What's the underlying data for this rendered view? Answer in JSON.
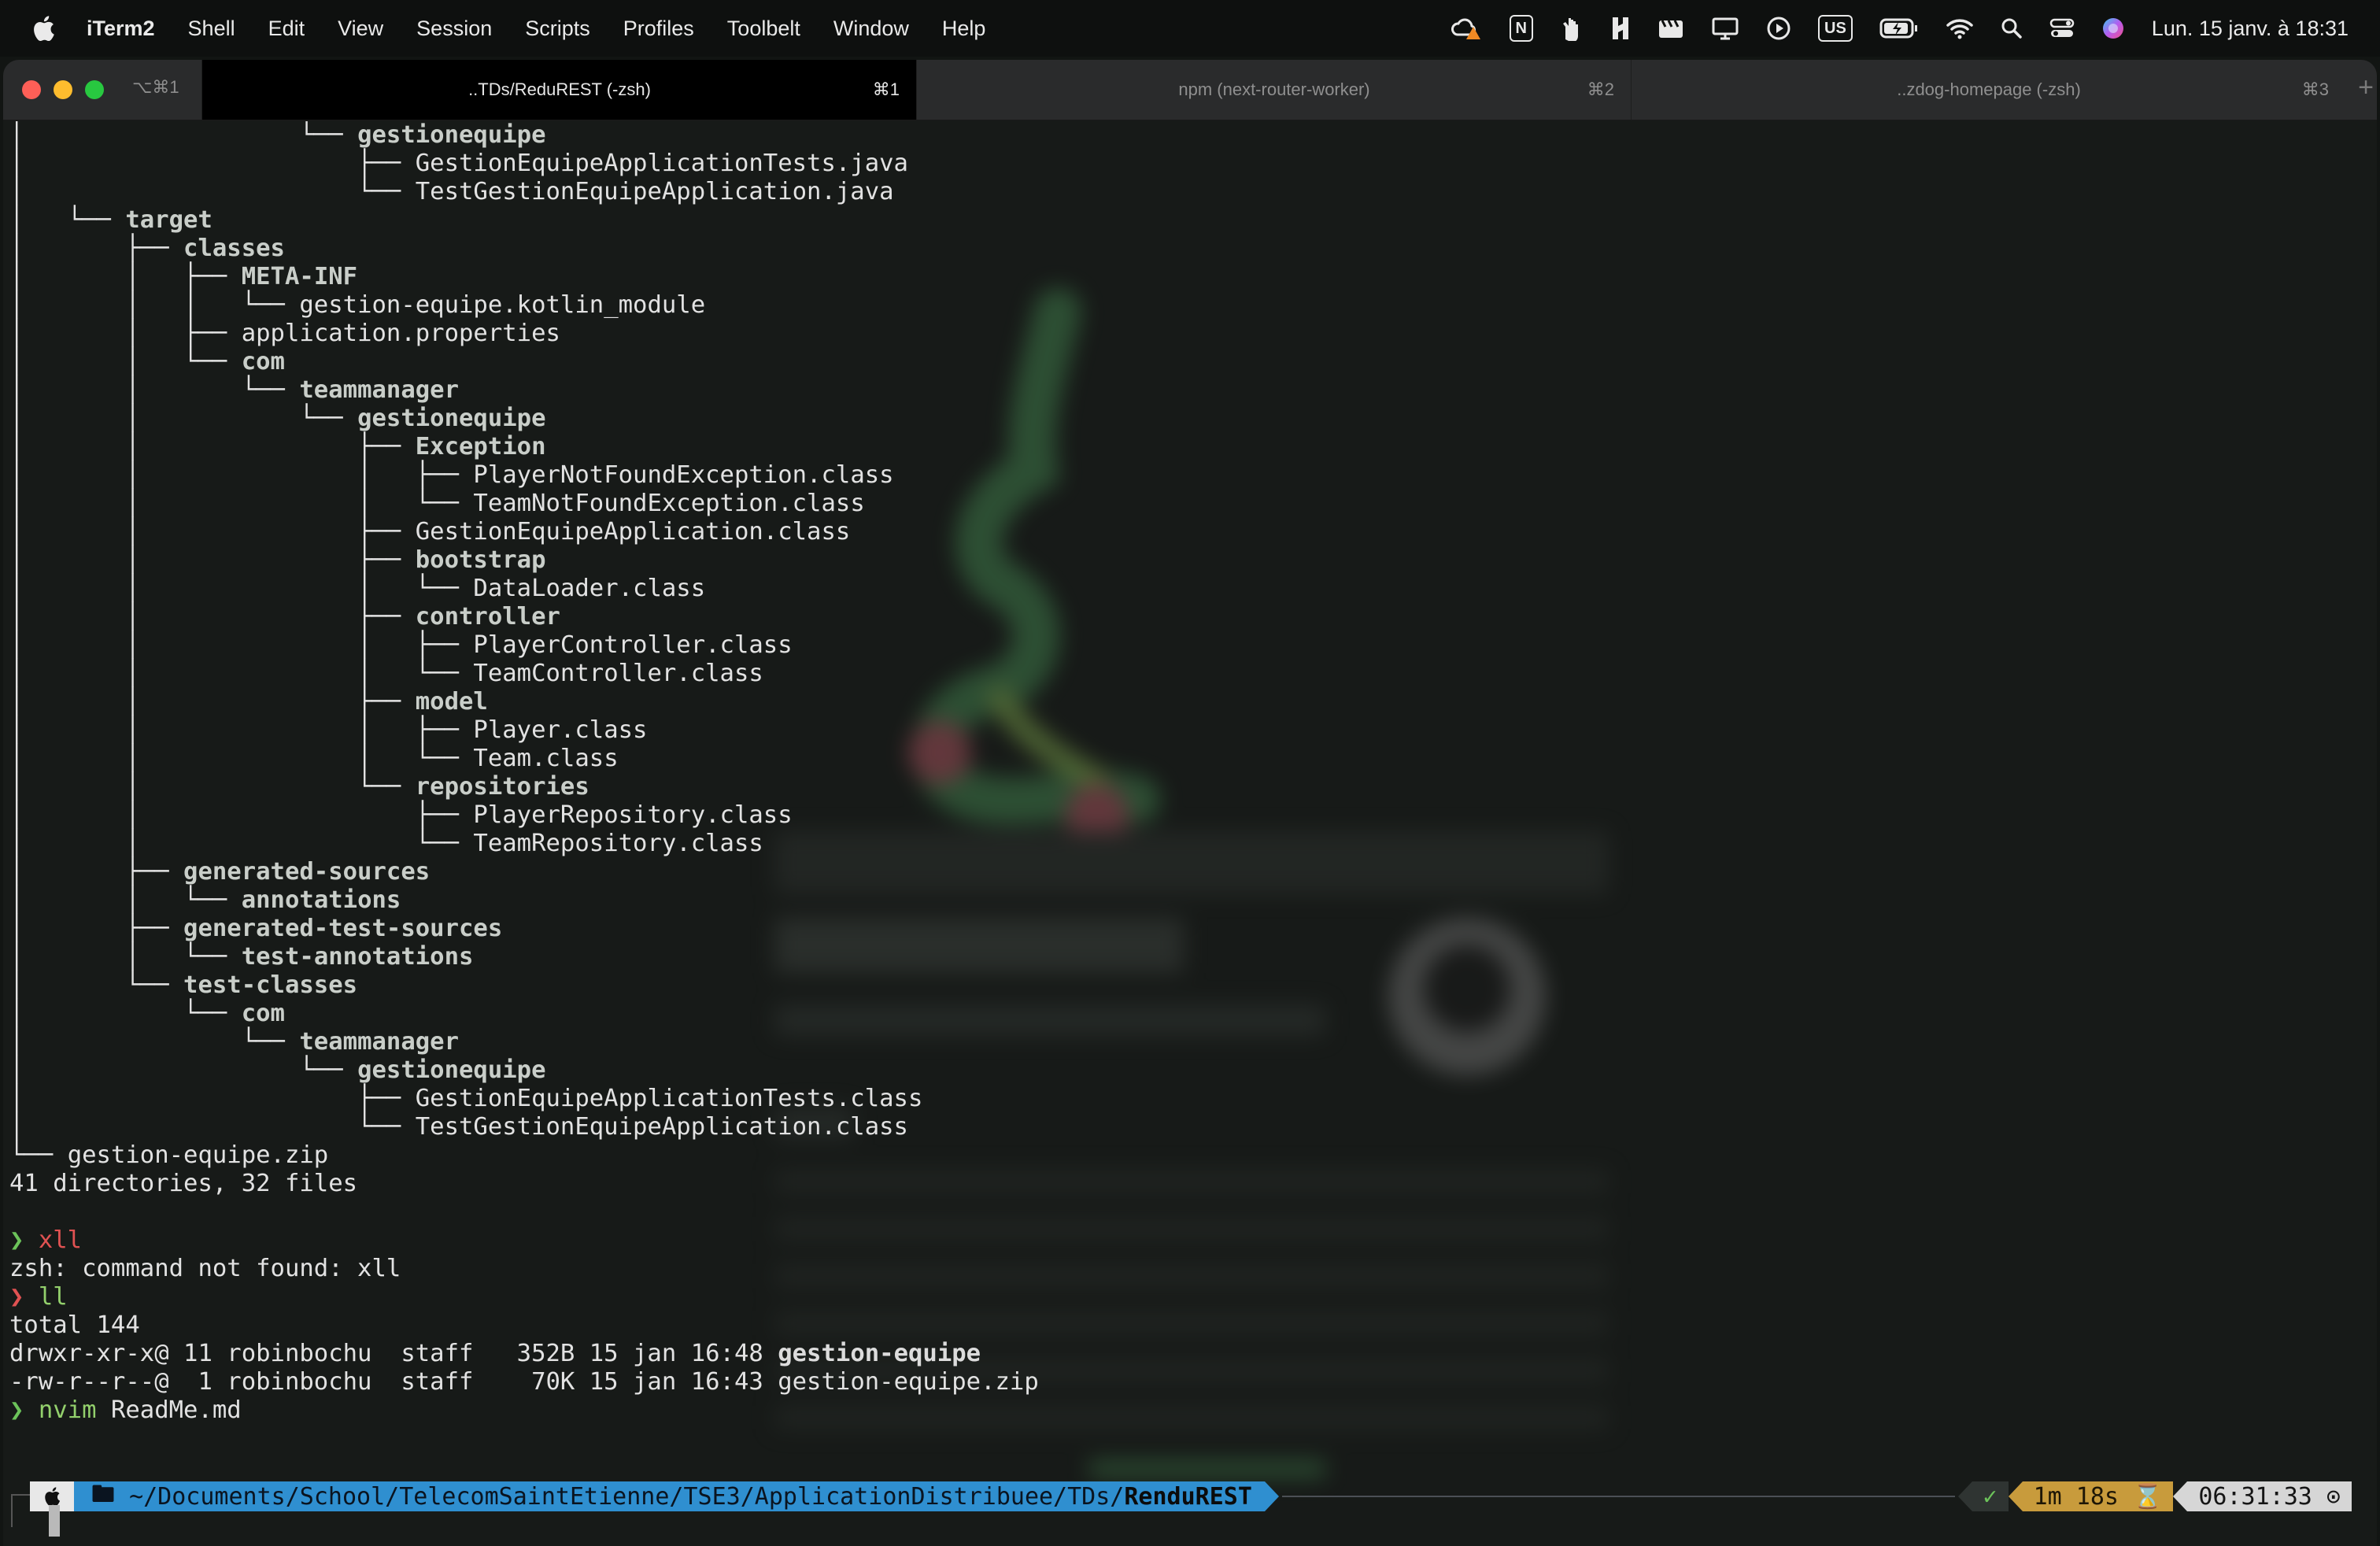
{
  "menubar": {
    "app_name": "iTerm2",
    "menus": [
      "Shell",
      "Edit",
      "View",
      "Session",
      "Scripts",
      "Profiles",
      "Toolbelt",
      "Window",
      "Help"
    ],
    "status_icons": [
      "cloud-warning-icon",
      "notion-icon",
      "hand-icon",
      "h-icon",
      "clapper-icon",
      "display-icon",
      "play-icon",
      "keyboard-layout-icon",
      "battery-icon",
      "wifi-icon",
      "search-icon",
      "control-center-icon",
      "siri-icon"
    ],
    "keyboard_layout": "US",
    "notion_letter": "N",
    "clock": "Lun. 15 janv. à 18:31"
  },
  "window": {
    "shortcut": "⌥⌘1",
    "tabs": [
      {
        "title": "..TDs/ReduREST (-zsh)",
        "shortcut": "⌘1",
        "active": true
      },
      {
        "title": "npm (next-router-worker)",
        "shortcut": "⌘2",
        "active": false
      },
      {
        "title": "..zdog-homepage (-zsh)",
        "shortcut": "⌘3",
        "active": false
      }
    ],
    "add_tab": "+"
  },
  "terminal": {
    "tree_lines": [
      {
        "prefix": "│                   └── ",
        "name": "gestionequipe",
        "kind": "dir"
      },
      {
        "prefix": "│                       ├── ",
        "name": "GestionEquipeApplicationTests.java",
        "kind": "file"
      },
      {
        "prefix": "│                       └── ",
        "name": "TestGestionEquipeApplication.java",
        "kind": "file"
      },
      {
        "prefix": "│   └── ",
        "name": "target",
        "kind": "dir"
      },
      {
        "prefix": "│       ├── ",
        "name": "classes",
        "kind": "dir"
      },
      {
        "prefix": "│       │   ├── ",
        "name": "META-INF",
        "kind": "dir"
      },
      {
        "prefix": "│       │   │   └── ",
        "name": "gestion-equipe.kotlin_module",
        "kind": "file"
      },
      {
        "prefix": "│       │   ├── ",
        "name": "application.properties",
        "kind": "file"
      },
      {
        "prefix": "│       │   └── ",
        "name": "com",
        "kind": "dir"
      },
      {
        "prefix": "│       │       └── ",
        "name": "teammanager",
        "kind": "dir"
      },
      {
        "prefix": "│       │           └── ",
        "name": "gestionequipe",
        "kind": "dir"
      },
      {
        "prefix": "│       │               ├── ",
        "name": "Exception",
        "kind": "dir"
      },
      {
        "prefix": "│       │               │   ├── ",
        "name": "PlayerNotFoundException.class",
        "kind": "file"
      },
      {
        "prefix": "│       │               │   └── ",
        "name": "TeamNotFoundException.class",
        "kind": "file"
      },
      {
        "prefix": "│       │               ├── ",
        "name": "GestionEquipeApplication.class",
        "kind": "file"
      },
      {
        "prefix": "│       │               ├── ",
        "name": "bootstrap",
        "kind": "dir"
      },
      {
        "prefix": "│       │               │   └── ",
        "name": "DataLoader.class",
        "kind": "file"
      },
      {
        "prefix": "│       │               ├── ",
        "name": "controller",
        "kind": "dir"
      },
      {
        "prefix": "│       │               │   ├── ",
        "name": "PlayerController.class",
        "kind": "file"
      },
      {
        "prefix": "│       │               │   └── ",
        "name": "TeamController.class",
        "kind": "file"
      },
      {
        "prefix": "│       │               ├── ",
        "name": "model",
        "kind": "dir"
      },
      {
        "prefix": "│       │               │   ├── ",
        "name": "Player.class",
        "kind": "file"
      },
      {
        "prefix": "│       │               │   └── ",
        "name": "Team.class",
        "kind": "file"
      },
      {
        "prefix": "│       │               └── ",
        "name": "repositories",
        "kind": "dir"
      },
      {
        "prefix": "│       │                   ├── ",
        "name": "PlayerRepository.class",
        "kind": "file"
      },
      {
        "prefix": "│       │                   └── ",
        "name": "TeamRepository.class",
        "kind": "file"
      },
      {
        "prefix": "│       ├── ",
        "name": "generated-sources",
        "kind": "dir"
      },
      {
        "prefix": "│       │   └── ",
        "name": "annotations",
        "kind": "dir"
      },
      {
        "prefix": "│       ├── ",
        "name": "generated-test-sources",
        "kind": "dir"
      },
      {
        "prefix": "│       │   └── ",
        "name": "test-annotations",
        "kind": "dir"
      },
      {
        "prefix": "│       └── ",
        "name": "test-classes",
        "kind": "dir"
      },
      {
        "prefix": "│           └── ",
        "name": "com",
        "kind": "dir"
      },
      {
        "prefix": "│               └── ",
        "name": "teammanager",
        "kind": "dir"
      },
      {
        "prefix": "│                   └── ",
        "name": "gestionequipe",
        "kind": "dir"
      },
      {
        "prefix": "│                       ├── ",
        "name": "GestionEquipeApplicationTests.class",
        "kind": "file"
      },
      {
        "prefix": "│                       └── ",
        "name": "TestGestionEquipeApplication.class",
        "kind": "file"
      },
      {
        "prefix": "└── ",
        "name": "gestion-equipe.zip",
        "kind": "file"
      }
    ],
    "summary": "41 directories, 32 files",
    "prompt_symbol": "❯",
    "cmd1": "xll",
    "cmd1_error": "zsh: command not found: xll",
    "cmd2": "ll",
    "total": "total 144",
    "ls_rows": [
      {
        "meta": "drwxr-xr-x@ 11 robinbochu  staff   352B 15 jan 16:48 ",
        "name": "gestion-equipe"
      },
      {
        "meta": "-rw-r--r--@  1 robinbochu  staff    70K 15 jan 16:43 ",
        "name": "gestion-equipe.zip"
      }
    ],
    "cmd3_prog": "nvim",
    "cmd3_arg": "ReadMe.md"
  },
  "powerline": {
    "path_prefix": "~/Documents/School/TelecomSaintEtienne/TSE3/ApplicationDistribuee/TDs/",
    "path_current": "RenduREST",
    "check": "✓",
    "duration": "1m 18s ⌛",
    "time": "06:31:33 ⊙"
  }
}
